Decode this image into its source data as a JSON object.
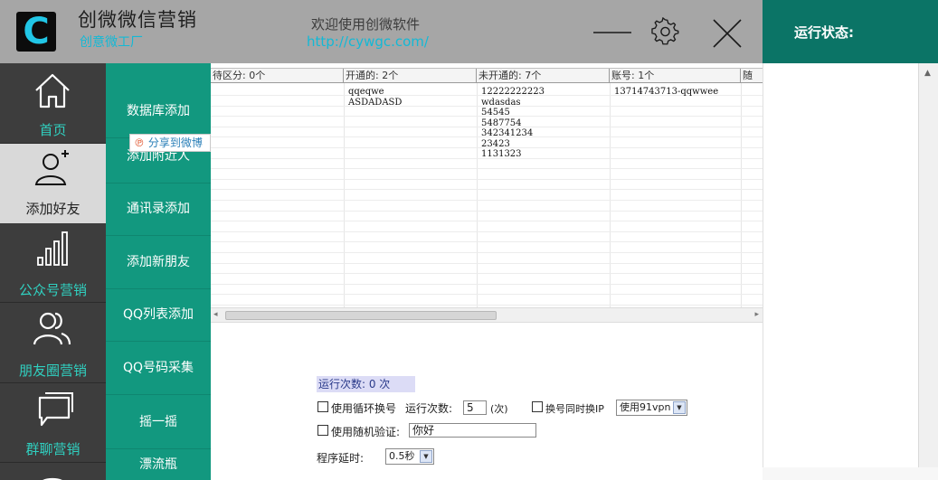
{
  "header": {
    "logo_letter": "C",
    "title": "创微微信营销",
    "subtitle": "创意微工厂",
    "welcome": "欢迎使用创微软件",
    "url": "http://cywgc.com/"
  },
  "status_panel": {
    "title": "运行状态:"
  },
  "nav": {
    "items": [
      {
        "label": "首页",
        "icon": "home-icon"
      },
      {
        "label": "添加好友",
        "icon": "add-user-icon"
      },
      {
        "label": "公众号营销",
        "icon": "bar-chart-icon"
      },
      {
        "label": "朋友圈营销",
        "icon": "people-icon"
      },
      {
        "label": "群聊营销",
        "icon": "chat-icon"
      }
    ]
  },
  "submenu": {
    "items": [
      {
        "label": "数据库添加"
      },
      {
        "label": "添加附近人"
      },
      {
        "label": "通讯录添加"
      },
      {
        "label": "添加新朋友"
      },
      {
        "label": "QQ列表添加"
      },
      {
        "label": "QQ号码采集"
      },
      {
        "label": "摇一摇"
      },
      {
        "label": "漂流瓶"
      }
    ]
  },
  "share": {
    "label": "分享到微博"
  },
  "table": {
    "columns": [
      {
        "header": "待区分: 0个",
        "values": []
      },
      {
        "header": "开通的: 2个",
        "values": [
          "qqeqwe",
          "ASDADASD"
        ]
      },
      {
        "header": "未开通的: 7个",
        "values": [
          "12222222223",
          "wdasdas",
          "54545",
          "5487754",
          "342341234",
          "23423",
          "1131323"
        ]
      },
      {
        "header": "账号: 1个",
        "values": [
          "13714743713-qqwwee"
        ]
      },
      {
        "header": "随",
        "values": []
      }
    ]
  },
  "controls": {
    "run_count_label": "运行次数: 0 次",
    "loop_switch_label": "使用循环换号",
    "run_times_label": "运行次数:",
    "run_times_value": "5",
    "run_times_unit": "(次)",
    "switch_ip_label": "换号同时换IP",
    "vpn_selected": "使用91vpn",
    "random_verify_label": "使用随机验证:",
    "random_verify_value": "你好",
    "delay_label": "程序延时:",
    "delay_selected": "0.5秒"
  },
  "colors": {
    "header_bg": "#a6a6a6",
    "status_bg": "#0b7466",
    "nav_bg": "#3c3c3c",
    "nav_active_bg": "#d9d9d9",
    "submenu_bg": "#12987f",
    "accent_cyan": "#13b9d6",
    "nav_label_teal": "#30d0c0"
  }
}
